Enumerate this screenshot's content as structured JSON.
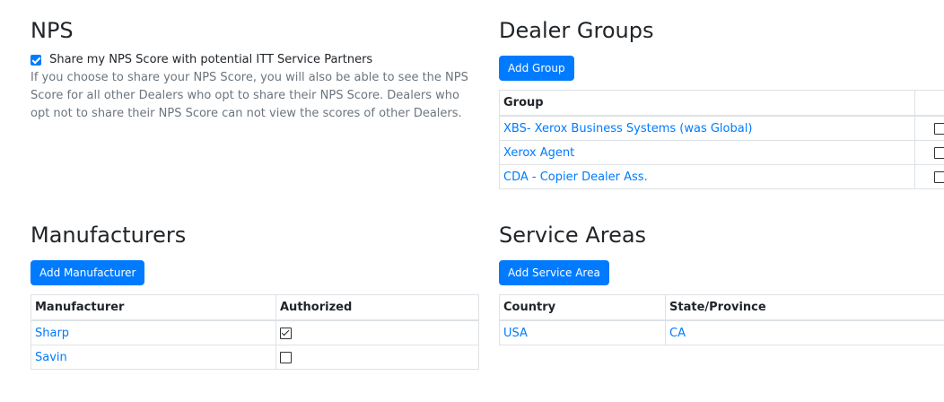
{
  "nps": {
    "title": "NPS",
    "share_checked": true,
    "share_label": "Share my NPS Score with potential ITT Service Partners",
    "description": "If you choose to share your NPS Score, you will also be able to see the NPS Score for all other Dealers who opt to share their NPS Score. Dealers who opt not to share their NPS Score can not view the scores of other Dealers."
  },
  "dealer_groups": {
    "title": "Dealer Groups",
    "add_label": "Add Group",
    "columns": [
      "Group",
      ""
    ],
    "rows": [
      {
        "group": "XBS- Xerox Business Systems (was Global)",
        "checked": false
      },
      {
        "group": "Xerox Agent",
        "checked": false
      },
      {
        "group": "CDA - Copier Dealer Ass.",
        "checked": false
      }
    ]
  },
  "manufacturers": {
    "title": "Manufacturers",
    "add_label": "Add Manufacturer",
    "columns": [
      "Manufacturer",
      "Authorized"
    ],
    "rows": [
      {
        "name": "Sharp",
        "authorized": true
      },
      {
        "name": "Savin",
        "authorized": false
      }
    ]
  },
  "service_areas": {
    "title": "Service Areas",
    "add_label": "Add Service Area",
    "columns": [
      "Country",
      "State/Province"
    ],
    "rows": [
      {
        "country": "USA",
        "state": "CA"
      }
    ]
  }
}
